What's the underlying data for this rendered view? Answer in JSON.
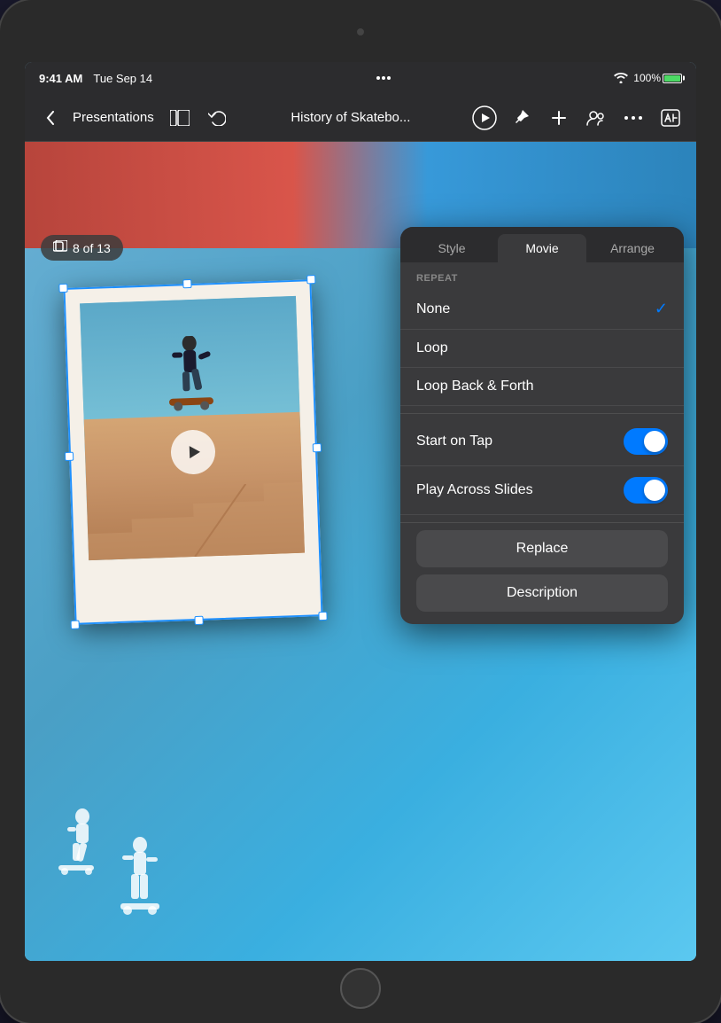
{
  "device": {
    "time": "9:41 AM",
    "date": "Tue Sep 14",
    "battery_percent": "100%"
  },
  "toolbar": {
    "back_label": "Presentations",
    "title": "History of Skatebo...",
    "three_dots": "···"
  },
  "slide_counter": {
    "text": "8 of 13"
  },
  "panel": {
    "tabs": [
      {
        "label": "Style",
        "active": false
      },
      {
        "label": "Movie",
        "active": true
      },
      {
        "label": "Arrange",
        "active": false
      }
    ],
    "repeat_label": "REPEAT",
    "repeat_options": [
      {
        "label": "None",
        "checked": true
      },
      {
        "label": "Loop",
        "checked": false
      },
      {
        "label": "Loop Back & Forth",
        "checked": false
      }
    ],
    "toggles": [
      {
        "label": "Start on Tap",
        "on": true
      },
      {
        "label": "Play Across Slides",
        "on": true
      }
    ],
    "buttons": [
      {
        "label": "Replace"
      },
      {
        "label": "Description"
      }
    ]
  }
}
